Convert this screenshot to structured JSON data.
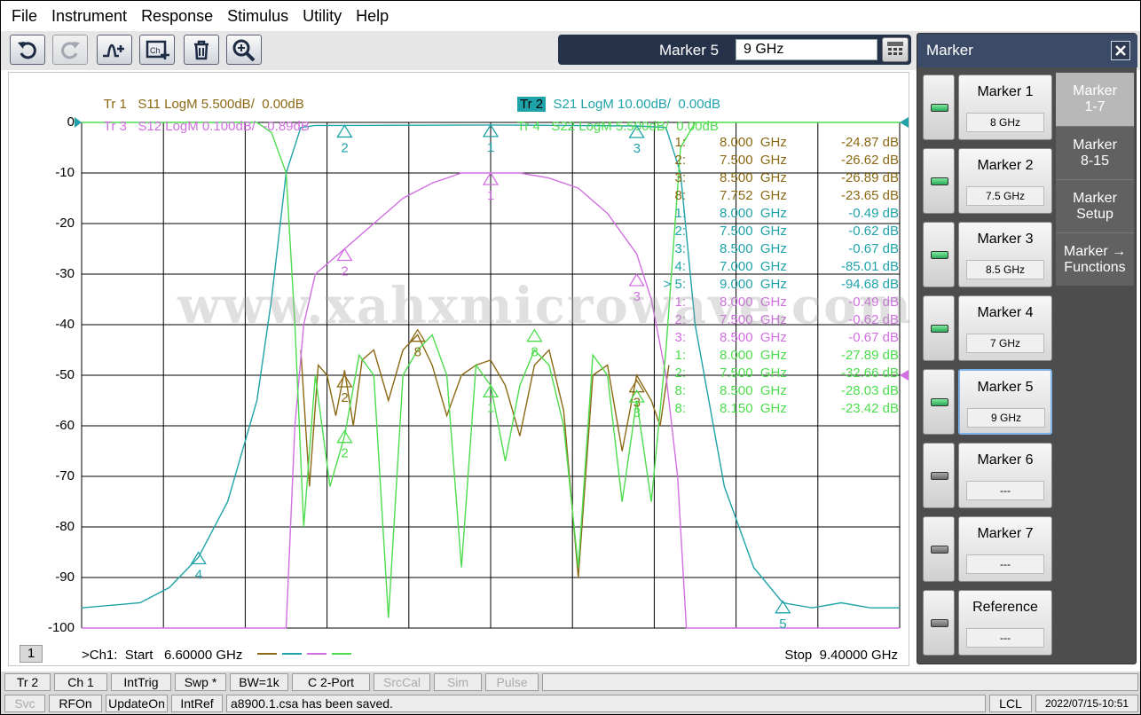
{
  "menu": [
    "File",
    "Instrument",
    "Response",
    "Stimulus",
    "Utility",
    "Help"
  ],
  "toolbar": {
    "buttons": [
      "undo-icon",
      "redo-icon",
      "add-trace-icon",
      "add-channel-icon",
      "delete-icon",
      "zoom-icon"
    ],
    "marker_label": "Marker 5",
    "marker_value": "9 GHz"
  },
  "traces": [
    {
      "id": "Tr 1",
      "desc": "S11 LogM 5.500dB/  0.00dB",
      "color": "#8b6914"
    },
    {
      "id": "Tr 2",
      "desc": "S21 LogM 10.00dB/  0.00dB",
      "color": "#1fa3a8"
    },
    {
      "id": "Tr 3",
      "desc": "S12 LogM 0.100dB/  -0.89dB",
      "color": "#d070e0"
    },
    {
      "id": "Tr 4",
      "desc": "S22 LogM 5.500dB/  0.00dB",
      "color": "#4ddc4d"
    }
  ],
  "active_trace": "Tr 2",
  "yticks": [
    "0",
    "-10",
    "-20",
    "-30",
    "-40",
    "-50",
    "-60",
    "-70",
    "-80",
    "-90",
    "-100"
  ],
  "marker_table": [
    {
      "id": "1:",
      "freq": "8.000  GHz",
      "val": "-24.87 dB",
      "color": "#8b6914"
    },
    {
      "id": "2:",
      "freq": "7.500  GHz",
      "val": "-26.62 dB",
      "color": "#8b6914"
    },
    {
      "id": "3:",
      "freq": "8.500  GHz",
      "val": "-26.89 dB",
      "color": "#8b6914"
    },
    {
      "id": "8:",
      "freq": "7.752  GHz",
      "val": "-23.65 dB",
      "color": "#8b6914"
    },
    {
      "id": "1:",
      "freq": "8.000  GHz",
      "val": "-0.49 dB",
      "color": "#1fa3a8"
    },
    {
      "id": "2:",
      "freq": "7.500  GHz",
      "val": "-0.62 dB",
      "color": "#1fa3a8"
    },
    {
      "id": "3:",
      "freq": "8.500  GHz",
      "val": "-0.67 dB",
      "color": "#1fa3a8"
    },
    {
      "id": "4:",
      "freq": "7.000  GHz",
      "val": "-85.01 dB",
      "color": "#1fa3a8"
    },
    {
      "id": "> 5:",
      "freq": "9.000  GHz",
      "val": "-94.68 dB",
      "color": "#1fa3a8"
    },
    {
      "id": "1:",
      "freq": "8.000  GHz",
      "val": "-0.49 dB",
      "color": "#d070e0"
    },
    {
      "id": "2:",
      "freq": "7.500  GHz",
      "val": "-0.62 dB",
      "color": "#d070e0"
    },
    {
      "id": "3:",
      "freq": "8.500  GHz",
      "val": "-0.67 dB",
      "color": "#d070e0"
    },
    {
      "id": "1:",
      "freq": "8.000  GHz",
      "val": "-27.89 dB",
      "color": "#4ddc4d"
    },
    {
      "id": "2:",
      "freq": "7.500  GHz",
      "val": "-32.66 dB",
      "color": "#4ddc4d"
    },
    {
      "id": "8:",
      "freq": "8.500  GHz",
      "val": "-28.03 dB",
      "color": "#4ddc4d"
    },
    {
      "id": "8:",
      "freq": "8.150  GHz",
      "val": "-23.42 dB",
      "color": "#4ddc4d"
    }
  ],
  "channel_number": "1",
  "start_label": ">Ch1:  Start   6.60000 GHz",
  "stop_label": "Stop  9.40000 GHz",
  "watermark": "www.xahxmicrowave.com",
  "panel": {
    "title": "Marker",
    "markers": [
      {
        "label": "Marker 1",
        "value": "8 GHz",
        "on": true
      },
      {
        "label": "Marker 2",
        "value": "7.5 GHz",
        "on": true
      },
      {
        "label": "Marker 3",
        "value": "8.5 GHz",
        "on": true
      },
      {
        "label": "Marker 4",
        "value": "7 GHz",
        "on": true
      },
      {
        "label": "Marker 5",
        "value": "9 GHz",
        "on": true
      },
      {
        "label": "Marker 6",
        "value": "---",
        "on": false
      },
      {
        "label": "Marker 7",
        "value": "---",
        "on": false
      },
      {
        "label": "Reference",
        "value": "---",
        "on": false
      }
    ],
    "tabs": [
      "Marker\n1-7",
      "Marker\n8-15",
      "Marker\nSetup",
      "Marker →\nFunctions"
    ]
  },
  "statusbar1": [
    "Tr 2",
    "Ch 1",
    "IntTrig",
    "Swp *",
    "BW=1k",
    "C  2-Port",
    "SrcCal",
    "Sim",
    "Pulse"
  ],
  "statusbar2": [
    "Svc",
    "RFOn",
    "UpdateOn",
    "IntRef"
  ],
  "status_message": "a8900.1.csa has been saved.",
  "status_lcl": "LCL",
  "status_time": "2022/07/15-10:51",
  "chart_data": {
    "type": "line",
    "x_range_ghz": [
      6.6,
      9.4
    ],
    "ylim": [
      -100,
      0
    ],
    "yticks": [
      0,
      -10,
      -20,
      -30,
      -40,
      -50,
      -60,
      -70,
      -80,
      -90,
      -100
    ],
    "xlabel": ">Ch1:  Start   6.60000 GHz ... Stop  9.40000 GHz",
    "ylabel": "",
    "grid": true,
    "series": [
      {
        "name": "S11",
        "color": "#8b6914",
        "x": [
          7.35,
          7.38,
          7.41,
          7.44,
          7.47,
          7.5,
          7.53,
          7.56,
          7.6,
          7.65,
          7.7,
          7.75,
          7.8,
          7.85,
          7.9,
          7.95,
          8.0,
          8.05,
          8.1,
          8.15,
          8.2,
          8.25,
          8.3,
          8.35,
          8.4,
          8.45,
          8.5,
          8.55,
          8.58,
          8.61
        ],
        "y": [
          -45,
          -72,
          -48,
          -50,
          -58,
          -49,
          -60,
          -47,
          -45,
          -55,
          -45,
          -42,
          -48,
          -58,
          -50,
          -48,
          -47,
          -52,
          -62,
          -48,
          -45,
          -57,
          -90,
          -50,
          -48,
          -65,
          -50,
          -55,
          -60,
          -48
        ]
      },
      {
        "name": "S21",
        "color": "#1fa3a8",
        "x": [
          6.6,
          6.8,
          6.9,
          7.0,
          7.1,
          7.2,
          7.25,
          7.3,
          7.35,
          7.4,
          7.5,
          8.0,
          8.5,
          8.6,
          8.65,
          8.7,
          8.8,
          8.9,
          9.0,
          9.1,
          9.2,
          9.3,
          9.4
        ],
        "y": [
          -96,
          -95,
          -92,
          -86,
          -75,
          -55,
          -35,
          -10,
          -1,
          -0.6,
          -0.6,
          -0.5,
          -0.7,
          -1,
          -10,
          -40,
          -72,
          -88,
          -95,
          -96,
          -95,
          -96,
          -96
        ]
      },
      {
        "name": "S12",
        "color": "#d070e0",
        "x": [
          6.6,
          7.3,
          7.33,
          7.36,
          7.4,
          7.5,
          7.6,
          7.7,
          7.8,
          7.9,
          8.0,
          8.1,
          8.2,
          8.3,
          8.4,
          8.5,
          8.55,
          8.6,
          8.64,
          8.67,
          9.4
        ],
        "y": [
          -100,
          -100,
          -60,
          -40,
          -30,
          -25,
          -20,
          -15,
          -12,
          -10,
          -10,
          -10,
          -11,
          -13,
          -18,
          -26,
          -35,
          -50,
          -70,
          -100,
          -100
        ]
      },
      {
        "name": "S22",
        "color": "#4ddc4d",
        "x": [
          6.6,
          7.0,
          7.2,
          7.25,
          7.3,
          7.33,
          7.36,
          7.4,
          7.45,
          7.5,
          7.55,
          7.6,
          7.65,
          7.7,
          7.75,
          7.8,
          7.85,
          7.9,
          7.95,
          8.0,
          8.05,
          8.1,
          8.15,
          8.2,
          8.25,
          8.3,
          8.35,
          8.4,
          8.45,
          8.5,
          8.55,
          8.6,
          8.65,
          8.7,
          9.4
        ],
        "y": [
          0,
          0,
          0,
          -2,
          -10,
          -40,
          -80,
          -50,
          -72,
          -62,
          -46,
          -50,
          -98,
          -50,
          -45,
          -42,
          -50,
          -88,
          -48,
          -52,
          -67,
          -52,
          -45,
          -48,
          -60,
          -88,
          -46,
          -50,
          -75,
          -55,
          -75,
          -45,
          -5,
          0,
          0
        ]
      }
    ],
    "markers": [
      {
        "label": "2",
        "series": "S21",
        "x": 7.5,
        "y": -0.6
      },
      {
        "label": "1",
        "series": "S21",
        "x": 8.0,
        "y": -0.5
      },
      {
        "label": "3",
        "series": "S21",
        "x": 8.5,
        "y": -0.7
      },
      {
        "label": "4",
        "series": "S21",
        "x": 7.0,
        "y": -85
      },
      {
        "label": "5",
        "series": "S21",
        "x": 9.0,
        "y": -94.7
      },
      {
        "label": "1",
        "series": "S12",
        "x": 8.0,
        "y": -10
      },
      {
        "label": "2",
        "series": "S12",
        "x": 7.5,
        "y": -25
      },
      {
        "label": "3",
        "series": "S12",
        "x": 8.5,
        "y": -30
      },
      {
        "label": "8",
        "series": "S11",
        "x": 7.75,
        "y": -41
      },
      {
        "label": "2",
        "series": "S11",
        "x": 7.5,
        "y": -50
      },
      {
        "label": "3",
        "series": "S11",
        "x": 8.5,
        "y": -51
      },
      {
        "label": "1",
        "series": "S22",
        "x": 8.0,
        "y": -52
      },
      {
        "label": "2",
        "series": "S22",
        "x": 7.5,
        "y": -61
      },
      {
        "label": "8",
        "series": "S22",
        "x": 8.15,
        "y": -41
      },
      {
        "label": "3",
        "series": "S22",
        "x": 8.5,
        "y": -53
      }
    ]
  }
}
